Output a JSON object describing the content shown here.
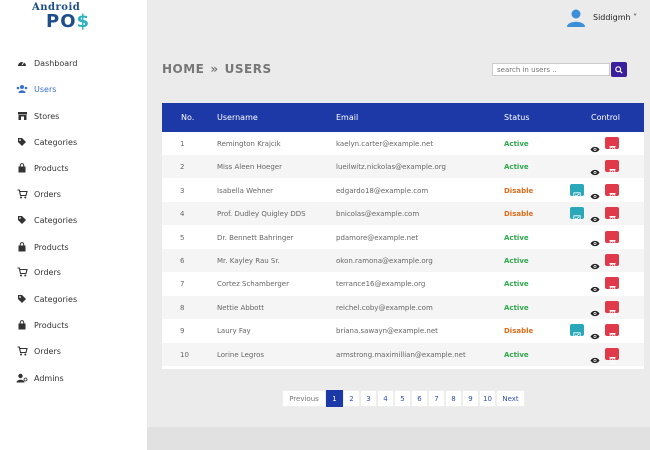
{
  "app": {
    "logo_line1": "Android",
    "logo_line2_a": "PO",
    "logo_line2_b": "$"
  },
  "user": {
    "name": "Siddigmh",
    "caret": "˅"
  },
  "sidebar": {
    "items": [
      {
        "label": "Dashboard",
        "icon": "dashboard-icon"
      },
      {
        "label": "Users",
        "icon": "users-icon",
        "active": true
      },
      {
        "label": "Stores",
        "icon": "store-icon"
      },
      {
        "label": "Categories",
        "icon": "tags-icon"
      },
      {
        "label": "Products",
        "icon": "bag-icon"
      },
      {
        "label": "Orders",
        "icon": "cart-icon"
      },
      {
        "label": "Categories",
        "icon": "tags-icon"
      },
      {
        "label": "Products",
        "icon": "bag-icon"
      },
      {
        "label": "Orders",
        "icon": "cart-icon"
      },
      {
        "label": "Categories",
        "icon": "tags-icon"
      },
      {
        "label": "Products",
        "icon": "bag-icon"
      },
      {
        "label": "Orders",
        "icon": "cart-icon"
      },
      {
        "label": "Admins",
        "icon": "admin-icon"
      }
    ]
  },
  "breadcrumb": {
    "home": "HOME",
    "separator": "»",
    "current": "USERS"
  },
  "search": {
    "placeholder": "search in users .."
  },
  "table": {
    "headers": {
      "no": "No.",
      "username": "Username",
      "email": "Email",
      "status": "Status",
      "control": "Control"
    },
    "rows": [
      {
        "no": "1",
        "username": "Remington Krajcik",
        "email": "kaelyn.carter@example.net",
        "status": "Active"
      },
      {
        "no": "2",
        "username": "Miss Aleen Hoeger",
        "email": "lueilwitz.nickolas@example.org",
        "status": "Active"
      },
      {
        "no": "3",
        "username": "Isabella Wehner",
        "email": "edgardo18@example.com",
        "status": "Disable"
      },
      {
        "no": "4",
        "username": "Prof. Dudley Quigley DDS",
        "email": "bnicolas@example.com",
        "status": "Disable"
      },
      {
        "no": "5",
        "username": "Dr. Bennett Bahringer",
        "email": "pdamore@example.net",
        "status": "Active"
      },
      {
        "no": "6",
        "username": "Mr. Kayley Rau Sr.",
        "email": "okon.ramona@example.org",
        "status": "Active"
      },
      {
        "no": "7",
        "username": "Cortez Schamberger",
        "email": "terrance16@example.org",
        "status": "Active"
      },
      {
        "no": "8",
        "username": "Nettie Abbott",
        "email": "reichel.coby@example.com",
        "status": "Active"
      },
      {
        "no": "9",
        "username": "Laury Fay",
        "email": "briana.sawayn@example.net",
        "status": "Disable"
      },
      {
        "no": "10",
        "username": "Lorine Legros",
        "email": "armstrong.maximillian@example.net",
        "status": "Active"
      }
    ]
  },
  "pagination": {
    "previous": "Previous",
    "pages": [
      "1",
      "2",
      "3",
      "4",
      "5",
      "6",
      "7",
      "8",
      "9",
      "10"
    ],
    "current": "1",
    "next": "Next"
  },
  "colors": {
    "header_bg": "#1d39a8",
    "active": "#2ea84b",
    "disable": "#e06c1a",
    "delete": "#e03a4a",
    "enable": "#2aa7b9"
  }
}
